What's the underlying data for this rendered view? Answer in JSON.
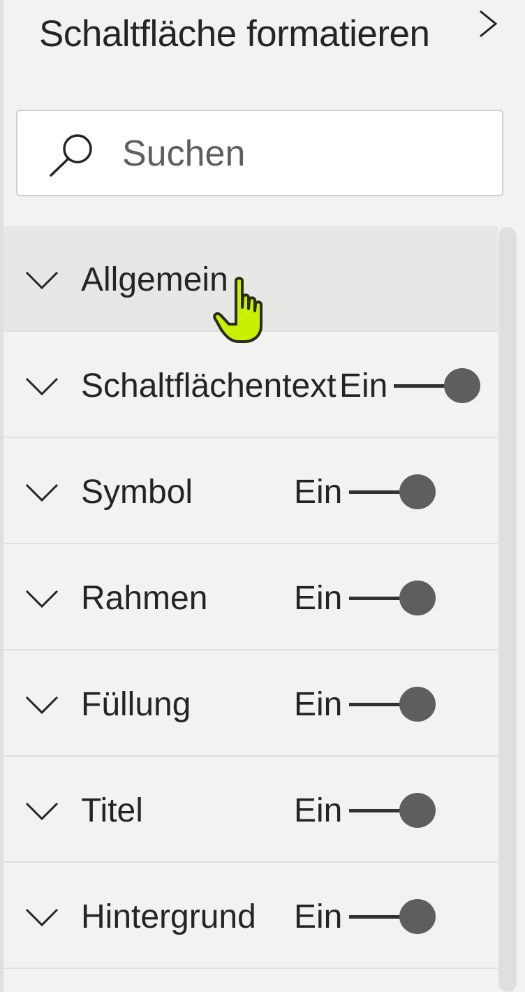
{
  "panel": {
    "title": "Schaltfläche formatieren"
  },
  "search": {
    "placeholder": "Suchen"
  },
  "sections": [
    {
      "label": "Allgemein"
    },
    {
      "label": "Schaltflächentext",
      "state": "Ein",
      "toggle_on": true
    },
    {
      "label": "Symbol",
      "state": "Ein",
      "toggle_on": true
    },
    {
      "label": "Rahmen",
      "state": "Ein",
      "toggle_on": true
    },
    {
      "label": "Füllung",
      "state": "Ein",
      "toggle_on": true
    },
    {
      "label": "Titel",
      "state": "Ein",
      "toggle_on": true
    },
    {
      "label": "Hintergrund",
      "state": "Ein",
      "toggle_on": true
    }
  ],
  "icons": {
    "collapse": "chevron-right-icon",
    "search": "search-icon",
    "expand": "chevron-down-icon",
    "pointer": "hand-pointer-icon"
  },
  "colors": {
    "panel_bg": "#f3f2f1",
    "toggle_knob": "#605e5c",
    "cursor": "#c8f000"
  }
}
